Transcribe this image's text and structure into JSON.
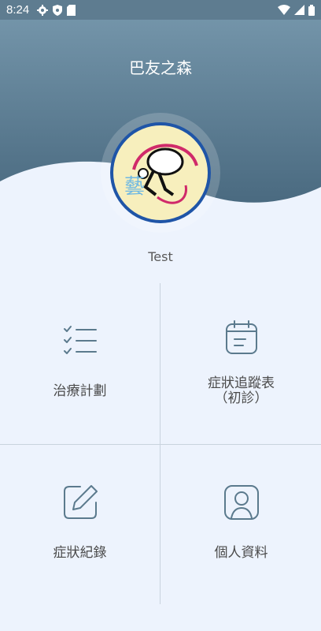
{
  "status_bar": {
    "time": "8:24",
    "left_icons": [
      "gear-icon",
      "shield-icon",
      "sd-card-icon"
    ],
    "right_icons": [
      "wifi-icon",
      "cell-signal-icon",
      "battery-icon"
    ]
  },
  "app": {
    "title": "巴友之森",
    "avatar_text": "藝",
    "username": "Test"
  },
  "menu": [
    {
      "label": "治療計劃",
      "icon": "checklist-icon"
    },
    {
      "label": "症狀追蹤表",
      "sublabel": "（初診）",
      "icon": "calendar-icon"
    },
    {
      "label": "症狀紀錄",
      "icon": "edit-icon"
    },
    {
      "label": "個人資料",
      "icon": "profile-icon"
    }
  ],
  "colors": {
    "header_top": "#7394a9",
    "header_bottom": "#4a6a80",
    "background": "#edf3fd",
    "icon_stroke": "#5b7a8d"
  }
}
